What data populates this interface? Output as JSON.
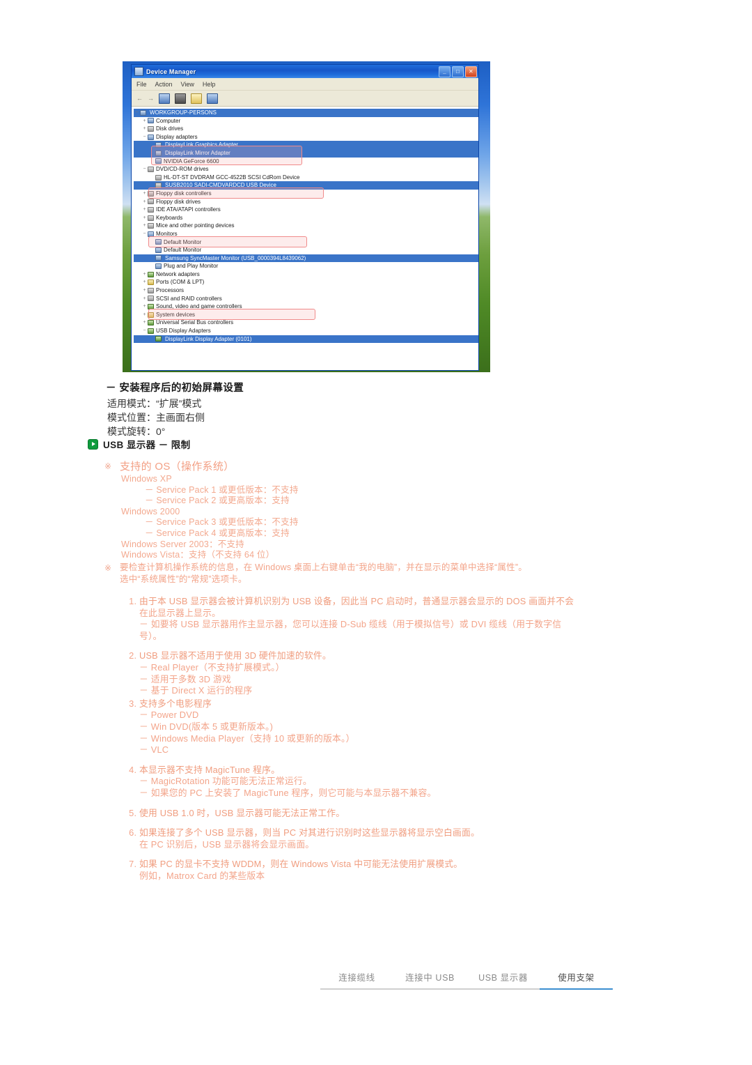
{
  "device_manager": {
    "window_title": "Device Manager",
    "window_buttons": {
      "minimize": "_",
      "maximize": "□",
      "close": "✕"
    },
    "menu": [
      "File",
      "Action",
      "View",
      "Help"
    ],
    "tree": [
      {
        "indent": 0,
        "expander": "−",
        "icon": "computer-icon",
        "label": "WORKGROUP-PERSONS",
        "selected": true
      },
      {
        "indent": 1,
        "expander": "+",
        "icon": "computer-icon",
        "label": "Computer",
        "selected": false
      },
      {
        "indent": 1,
        "expander": "+",
        "icon": "disk-icon",
        "label": "Disk drives",
        "selected": false
      },
      {
        "indent": 1,
        "expander": "−",
        "icon": "display-icon",
        "label": "Display adapters",
        "selected": false
      },
      {
        "indent": 2,
        "expander": "",
        "icon": "display-icon",
        "label": "DisplayLink Graphics Adapter",
        "selected": true
      },
      {
        "indent": 2,
        "expander": "",
        "icon": "display-icon",
        "label": "DisplayLink Mirror Adapter",
        "selected": true
      },
      {
        "indent": 2,
        "expander": "",
        "icon": "display-icon",
        "label": "NVIDIA GeForce 6600",
        "selected": false
      },
      {
        "indent": 1,
        "expander": "−",
        "icon": "cdrom-icon",
        "label": "DVD/CD-ROM drives",
        "selected": false
      },
      {
        "indent": 2,
        "expander": "",
        "icon": "cdrom-icon",
        "label": "HL-DT-ST DVDRAM GCC-4522B SCSI CdRom Device",
        "selected": false
      },
      {
        "indent": 2,
        "expander": "",
        "icon": "cdrom-icon",
        "label": "SUSB2010 SADI-CMDVARDCD USB Device",
        "selected": true
      },
      {
        "indent": 1,
        "expander": "+",
        "icon": "floppy-icon",
        "label": "Floppy disk controllers",
        "selected": false
      },
      {
        "indent": 1,
        "expander": "+",
        "icon": "floppy-icon",
        "label": "Floppy disk drives",
        "selected": false
      },
      {
        "indent": 1,
        "expander": "+",
        "icon": "ide-icon",
        "label": "IDE ATA/ATAPI controllers",
        "selected": false
      },
      {
        "indent": 1,
        "expander": "+",
        "icon": "keyboard-icon",
        "label": "Keyboards",
        "selected": false
      },
      {
        "indent": 1,
        "expander": "+",
        "icon": "mouse-icon",
        "label": "Mice and other pointing devices",
        "selected": false
      },
      {
        "indent": 1,
        "expander": "−",
        "icon": "monitor-icon",
        "label": "Monitors",
        "selected": false
      },
      {
        "indent": 2,
        "expander": "",
        "icon": "monitor-icon",
        "label": "Default Monitor",
        "selected": false
      },
      {
        "indent": 2,
        "expander": "",
        "icon": "monitor-icon",
        "label": "Default Monitor",
        "selected": false
      },
      {
        "indent": 2,
        "expander": "",
        "icon": "monitor-icon",
        "label": "Samsung SyncMaster Monitor (USB_0000394L8439062)",
        "selected": true
      },
      {
        "indent": 2,
        "expander": "",
        "icon": "monitor-icon",
        "label": "Plug and Play Monitor",
        "selected": false
      },
      {
        "indent": 1,
        "expander": "+",
        "icon": "network-icon",
        "label": "Network adapters",
        "selected": false
      },
      {
        "indent": 1,
        "expander": "+",
        "icon": "port-icon",
        "label": "Ports (COM & LPT)",
        "selected": false
      },
      {
        "indent": 1,
        "expander": "+",
        "icon": "processor-icon",
        "label": "Processors",
        "selected": false
      },
      {
        "indent": 1,
        "expander": "+",
        "icon": "scsi-icon",
        "label": "SCSI and RAID controllers",
        "selected": false
      },
      {
        "indent": 1,
        "expander": "+",
        "icon": "sound-icon",
        "label": "Sound, video and game controllers",
        "selected": false
      },
      {
        "indent": 1,
        "expander": "+",
        "icon": "system-icon",
        "label": "System devices",
        "selected": false
      },
      {
        "indent": 1,
        "expander": "+",
        "icon": "usb-icon",
        "label": "Universal Serial Bus controllers",
        "selected": false
      },
      {
        "indent": 1,
        "expander": "−",
        "icon": "usb-icon",
        "label": "USB Display Adapters",
        "selected": false
      },
      {
        "indent": 2,
        "expander": "",
        "icon": "usb-icon",
        "label": "DisplayLink Display Adapter (0101)",
        "selected": true
      }
    ],
    "highlight_color": "#f08a8a"
  },
  "initial_screen": {
    "heading": "－ 安装程序后的初始屏幕设置",
    "line1": "适用模式：“扩展”模式",
    "line2": "模式位置：主画面右侧",
    "line3": "模式旋转：0°"
  },
  "section": {
    "icon": "green-play-icon",
    "title": "USB 显示器 － 限制"
  },
  "supported_os": {
    "marker": "※",
    "title": "支持的 OS（操作系统）",
    "lines": [
      {
        "text": "Windows XP",
        "indent": false
      },
      {
        "text": "－ Service Pack 1 或更低版本：不支持",
        "indent": true
      },
      {
        "text": "－ Service Pack 2 或更高版本：支持",
        "indent": true
      },
      {
        "text": "Windows 2000",
        "indent": false
      },
      {
        "text": "－ Service Pack 3 或更低版本：不支持",
        "indent": true
      },
      {
        "text": "－ Service Pack 4 或更高版本：支持",
        "indent": true
      },
      {
        "text": "Windows Server 2003：不支持",
        "indent": false
      },
      {
        "text": "Windows Vista：支持（不支持 64 位）",
        "indent": false
      }
    ]
  },
  "check_os_note": {
    "marker": "※",
    "line1": "要检查计算机操作系统的信息，在 Windows 桌面上右键单击“我的电脑”，并在显示的菜单中选择“属性”。",
    "line2": "选中“系统属性”的“常规”选项卡。"
  },
  "limitations": [
    {
      "head": "由于本 USB 显示器会被计算机识别为 USB 设备，因此当 PC 启动时，普通显示器会显示的 DOS 画面并不会",
      "subs": [
        "在此显示器上显示。",
        "－ 如要将 USB 显示器用作主显示器，您可以连接 D-Sub 缆线（用于模拟信号）或 DVI 缆线（用于数字信",
        "号）。"
      ]
    },
    {
      "head": "USB 显示器不适用于使用 3D 硬件加速的软件。",
      "subs": [
        "－ Real Player（不支持扩展模式。）",
        "－ 适用于多数 3D 游戏",
        "－ 基于 Direct X 运行的程序"
      ]
    },
    {
      "head": "支持多个电影程序",
      "subs": [
        "－ Power DVD",
        "－ Win DVD(版本 5 或更新版本。)",
        "－ Windows Media Player（支持 10 或更新的版本。）",
        "－ VLC"
      ]
    },
    {
      "head": "本显示器不支持 MagicTune 程序。",
      "subs": [
        "－ MagicRotation 功能可能无法正常运行。",
        "－ 如果您的 PC 上安装了 MagicTune 程序，则它可能与本显示器不兼容。"
      ]
    },
    {
      "head": "使用 USB 1.0 时，USB 显示器可能无法正常工作。",
      "subs": []
    },
    {
      "head": "如果连接了多个 USB 显示器，则当 PC 对其进行识别时这些显示器将显示空白画面。",
      "subs": [
        "在 PC 识别后，USB 显示器将会显示画面。"
      ]
    },
    {
      "head": "如果 PC 的显卡不支持 WDDM，则在 Windows Vista 中可能无法使用扩展模式。",
      "subs": [
        "例如，Matrox Card 的某些版本"
      ]
    }
  ],
  "footer_tabs": [
    {
      "label": "连接缆线",
      "active": false
    },
    {
      "label": "连接中 USB",
      "active": false
    },
    {
      "label": "USB 显示器",
      "active": false
    },
    {
      "label": "使用支架",
      "active": true
    }
  ],
  "colors": {
    "accent_blue": "#3b8ed0",
    "body_pink": "#f3a48a",
    "green_icon": "#0f9b3d",
    "highlight_red": "#f08a8a"
  }
}
